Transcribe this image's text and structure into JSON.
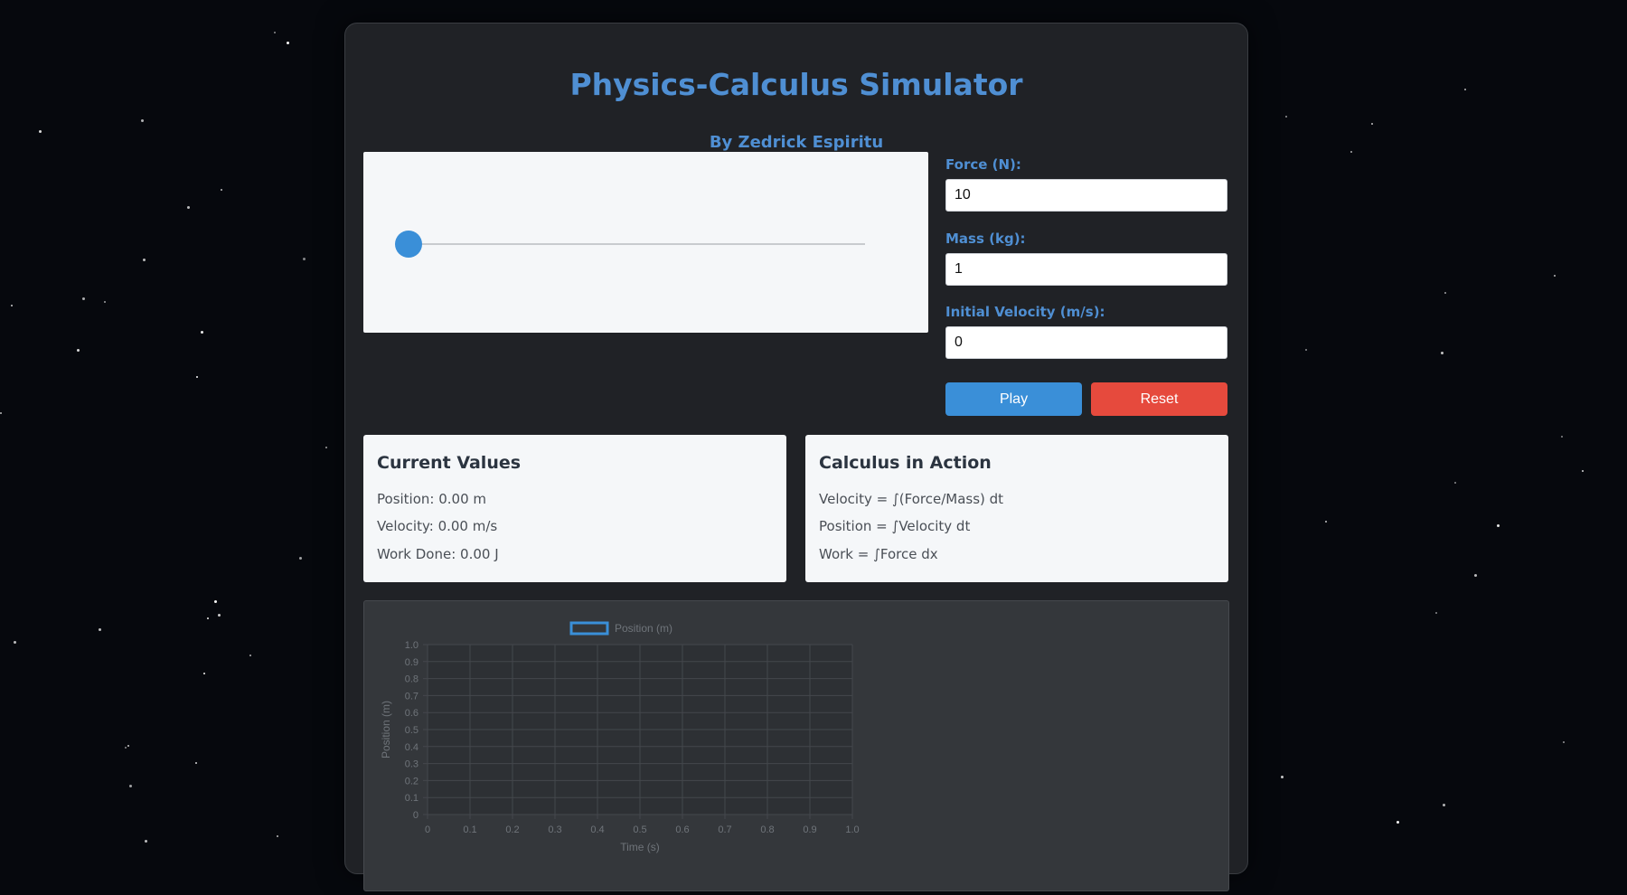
{
  "app": {
    "title": "Physics-Calculus Simulator",
    "subtitle": "By Zedrick Espiritu"
  },
  "controls": {
    "force_label": "Force (N):",
    "force_value": "10",
    "mass_label": "Mass (kg):",
    "mass_value": "1",
    "velocity_label": "Initial Velocity (m/s):",
    "velocity_value": "0",
    "play_label": "Play",
    "reset_label": "Reset"
  },
  "current_values": {
    "heading": "Current Values",
    "position": "Position: 0.00 m",
    "velocity": "Velocity: 0.00 m/s",
    "work": "Work Done: 0.00 J"
  },
  "calculus": {
    "heading": "Calculus in Action",
    "velocity": "Velocity = ∫(Force/Mass) dt",
    "position": "Position = ∫Velocity dt",
    "work": "Work = ∫Force dx"
  },
  "colors": {
    "accent": "#4f8fd3",
    "play": "#3a8fd8",
    "reset": "#e64a3d",
    "ball": "#3a8fd8"
  },
  "chart_data": {
    "type": "line",
    "series": [
      {
        "name": "Position (m)",
        "x": [],
        "y": []
      }
    ],
    "xlabel": "Time (s)",
    "ylabel": "Position (m)",
    "xlim": [
      0,
      1.0
    ],
    "ylim": [
      0,
      1.0
    ],
    "x_ticks": [
      "0",
      "0.1",
      "0.2",
      "0.3",
      "0.4",
      "0.5",
      "0.6",
      "0.7",
      "0.8",
      "0.9",
      "1.0"
    ],
    "y_ticks": [
      "0",
      "0.1",
      "0.2",
      "0.3",
      "0.4",
      "0.5",
      "0.6",
      "0.7",
      "0.8",
      "0.9",
      "1.0"
    ],
    "grid": true,
    "legend": "top",
    "series_color": "#3a8fd8"
  }
}
